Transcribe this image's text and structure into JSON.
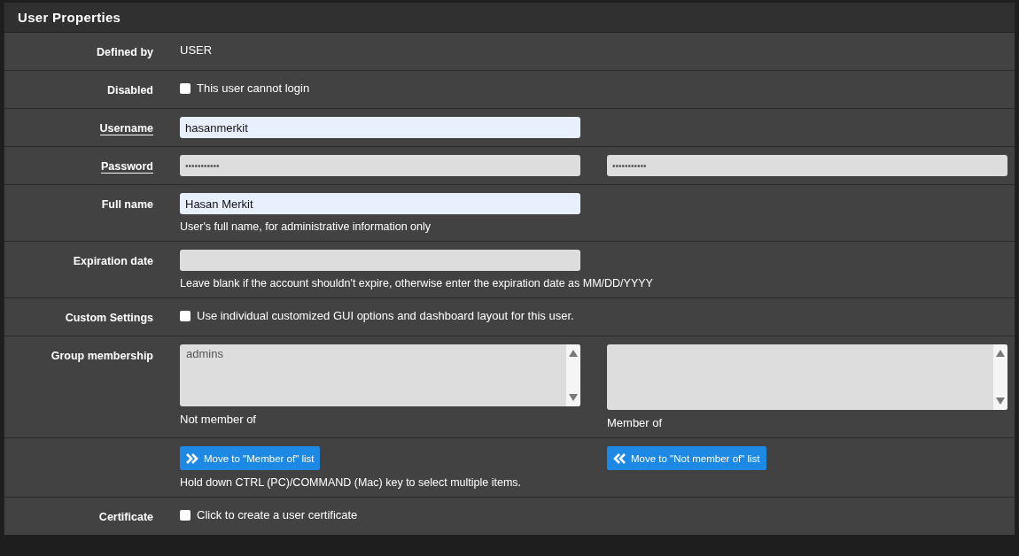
{
  "panel": {
    "title": "User Properties"
  },
  "rows": [
    {
      "kind": "text",
      "label": "Defined by",
      "underlined": false,
      "value": "USER"
    },
    {
      "kind": "checkbox",
      "label": "Disabled",
      "underlined": false,
      "checked": false,
      "text": "This user cannot login"
    },
    {
      "kind": "input",
      "label": "Username",
      "underlined": true,
      "value": "hasanmerkit",
      "autofilled": true
    },
    {
      "kind": "password",
      "label": "Password",
      "underlined": true,
      "fields": [
        {
          "value": "•••••••••••",
          "autofilled": false
        },
        {
          "value": "•••••••••••",
          "autofilled": false
        }
      ]
    },
    {
      "kind": "input",
      "label": "Full name",
      "underlined": false,
      "value": "Hasan Merkit",
      "autofilled": true,
      "help": "User's full name, for administrative information only"
    },
    {
      "kind": "input",
      "label": "Expiration date",
      "underlined": false,
      "autofilled": false,
      "help": "Leave blank if the account shouldn't expire, otherwise enter the expiration date as MM/DD/YYYY"
    },
    {
      "kind": "checkbox",
      "label": "Custom Settings",
      "underlined": false,
      "checked": false,
      "text": "Use individual customized GUI options and dashboard layout for this user."
    },
    {
      "kind": "lists",
      "label": "Group membership",
      "underlined": false,
      "lists": [
        {
          "options": [
            "admins"
          ],
          "caption": "Not member of"
        },
        {
          "caption": "Member of"
        }
      ]
    },
    {
      "kind": "buttons",
      "buttons": [
        {
          "label": "Move to \"Member of\" list",
          "kind": "right"
        },
        {
          "label": "Move to \"Not member of\" list",
          "kind": "left"
        }
      ],
      "help": "Hold down CTRL (PC)/COMMAND (Mac) key to select multiple items."
    },
    {
      "kind": "checkbox",
      "label": "Certificate",
      "underlined": false,
      "checked": false,
      "text": "Click to create a user certificate"
    }
  ]
}
